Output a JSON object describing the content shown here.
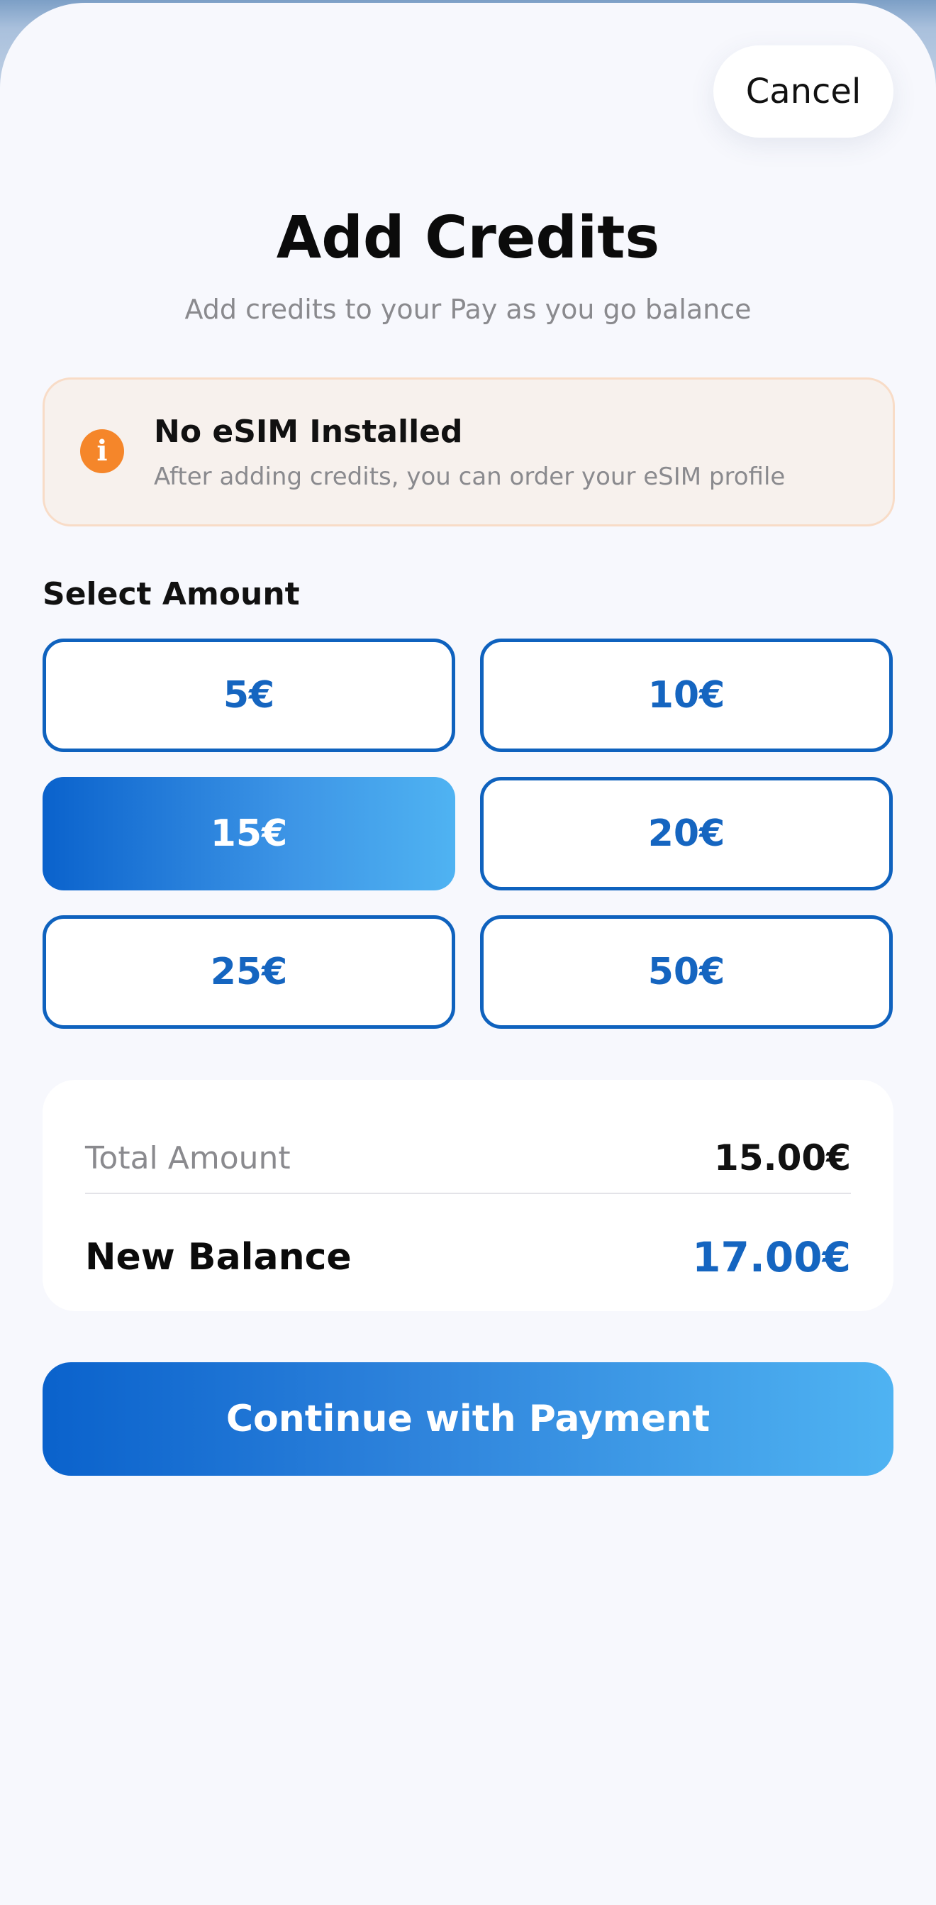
{
  "header": {
    "cancel_label": "Cancel",
    "title": "Add Credits",
    "subtitle": "Add credits to your Pay as you go balance"
  },
  "notice": {
    "icon": "info-icon",
    "icon_glyph": "i",
    "title": "No eSIM Installed",
    "text": "After adding credits, you can order your eSIM profile",
    "accent_color": "#f5862a"
  },
  "amounts": {
    "label": "Select Amount",
    "options": [
      "5€",
      "10€",
      "15€",
      "20€",
      "25€",
      "50€"
    ],
    "selected": "15€"
  },
  "summary": {
    "total_label": "Total Amount",
    "total_value": "15.00€",
    "balance_label": "New Balance",
    "balance_value": "17.00€"
  },
  "actions": {
    "continue_label": "Continue with Payment"
  },
  "colors": {
    "primary": "#1565c0",
    "gradient_start": "#0a62cc",
    "gradient_end": "#4fb3f2",
    "background": "#f7f8fd"
  }
}
